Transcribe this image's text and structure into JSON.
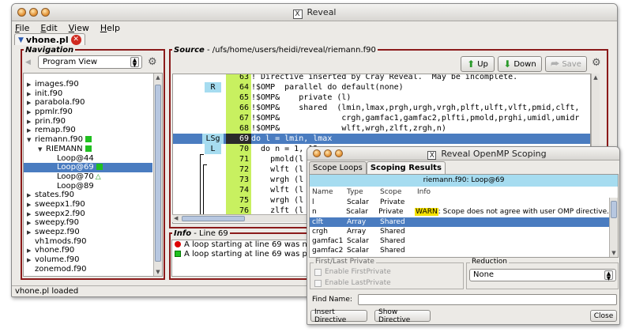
{
  "main_window": {
    "title": "Reveal",
    "menu": [
      "File",
      "Edit",
      "View",
      "Help"
    ],
    "doc_tab": "vhone.pl",
    "status": "vhone.pl loaded"
  },
  "navigation": {
    "label": "Navigation",
    "view_select": "Program View",
    "items": [
      {
        "text": "images.f90",
        "indent": 0,
        "twisty": "▶"
      },
      {
        "text": "init.f90",
        "indent": 0,
        "twisty": "▶"
      },
      {
        "text": "parabola.f90",
        "indent": 0,
        "twisty": "▶"
      },
      {
        "text": "ppmlr.f90",
        "indent": 0,
        "twisty": "▶"
      },
      {
        "text": "prin.f90",
        "indent": 0,
        "twisty": "▶"
      },
      {
        "text": "remap.f90",
        "indent": 0,
        "twisty": "▶"
      },
      {
        "text": "riemann.f90",
        "indent": 0,
        "twisty": "▼",
        "mark": "green"
      },
      {
        "text": "RIEMANN",
        "indent": 1,
        "twisty": "▼",
        "mark": "green"
      },
      {
        "text": "Loop@44",
        "indent": 2,
        "twisty": ""
      },
      {
        "text": "Loop@69",
        "indent": 2,
        "twisty": "",
        "mark": "green",
        "selected": true
      },
      {
        "text": "Loop@70",
        "indent": 2,
        "twisty": "",
        "mark": "triangle"
      },
      {
        "text": "Loop@89",
        "indent": 2,
        "twisty": ""
      },
      {
        "text": "states.f90",
        "indent": 0,
        "twisty": "▶"
      },
      {
        "text": "sweepx1.f90",
        "indent": 0,
        "twisty": "▶"
      },
      {
        "text": "sweepx2.f90",
        "indent": 0,
        "twisty": "▶"
      },
      {
        "text": "sweepy.f90",
        "indent": 0,
        "twisty": "▶"
      },
      {
        "text": "sweepz.f90",
        "indent": 0,
        "twisty": "▶"
      },
      {
        "text": "vh1mods.f90",
        "indent": 0,
        "twisty": ""
      },
      {
        "text": "vhone.f90",
        "indent": 0,
        "twisty": "▶"
      },
      {
        "text": "volume.f90",
        "indent": 0,
        "twisty": "▶"
      },
      {
        "text": "zonemod.f90",
        "indent": 0,
        "twisty": ""
      }
    ]
  },
  "source": {
    "label": "Source",
    "path": " - /ufs/home/users/heidi/reveal/riemann.f90",
    "up_label": "Up",
    "down_label": "Down",
    "save_label": "Save",
    "lines": [
      {
        "tag": "",
        "num": "63",
        "code": "! Directive inserted by Cray Reveal.  May be incomplete."
      },
      {
        "tag": "R",
        "num": "64",
        "code": "!$OMP  parallel do default(none)"
      },
      {
        "tag": "",
        "num": "65",
        "code": "!$OMP&    private (l)"
      },
      {
        "tag": "",
        "num": "66",
        "code": "!$OMP&    shared  (lmin,lmax,prgh,urgh,vrgh,plft,ulft,vlft,pmid,clft,"
      },
      {
        "tag": "",
        "num": "67",
        "code": "!$OMP&             crgh,gamfac1,gamfac2,plfti,pmold,prghi,umidl,umidr"
      },
      {
        "tag": "",
        "num": "68",
        "code": "!$OMP&             wlft,wrgh,zlft,zrgh,n)"
      },
      {
        "tag": "LSg",
        "num": "69",
        "code": "do l = lmin, lmax",
        "highlight": true
      },
      {
        "tag": "L",
        "num": "70",
        "code": "  do n = 1, 12"
      },
      {
        "tag": "",
        "num": "71",
        "code": "    pmold(l"
      },
      {
        "tag": "",
        "num": "72",
        "code": "    wlft (l"
      },
      {
        "tag": "",
        "num": "73",
        "code": "    wrgh (l"
      },
      {
        "tag": "",
        "num": "74",
        "code": "    wlft (l"
      },
      {
        "tag": "",
        "num": "75",
        "code": "    wrgh (l"
      },
      {
        "tag": "",
        "num": "76",
        "code": "    zlft (l"
      }
    ]
  },
  "info": {
    "label": "Info",
    "line": " - Line 69",
    "messages": [
      {
        "icon": "red",
        "text": "A loop starting at line 69 was not"
      },
      {
        "icon": "green",
        "text": "A loop starting at line 69 was pa"
      }
    ]
  },
  "scoping": {
    "title": "Reveal OpenMP Scoping",
    "tabs": [
      "Scope Loops",
      "Scoping Results"
    ],
    "caption": "riemann.f90: Loop@69",
    "columns": [
      "Name",
      "Type",
      "Scope",
      "Info"
    ],
    "rows": [
      {
        "name": "l",
        "type": "Scalar",
        "scope": "Private",
        "warn": "",
        "info": ""
      },
      {
        "name": "n",
        "type": "Scalar",
        "scope": "Private",
        "warn": "WARN",
        "info": ": Scope does not agree with user OMP directive."
      },
      {
        "name": "clft",
        "type": "Array",
        "scope": "Shared",
        "warn": "",
        "info": "",
        "selected": true
      },
      {
        "name": "crgh",
        "type": "Array",
        "scope": "Shared",
        "warn": "",
        "info": ""
      },
      {
        "name": "gamfac1",
        "type": "Scalar",
        "scope": "Shared",
        "warn": "",
        "info": ""
      },
      {
        "name": "gamfac2",
        "type": "Scalar",
        "scope": "Shared",
        "warn": "",
        "info": ""
      }
    ],
    "first_last_label": "First/Last Private",
    "enable_first": "Enable FirstPrivate",
    "enable_last": "Enable LastPrivate",
    "reduction_label": "Reduction",
    "reduction_value": "None",
    "find_label": "Find Name:",
    "insert_label": "Insert Directive",
    "show_label": "Show Directive",
    "close_label": "Close"
  }
}
